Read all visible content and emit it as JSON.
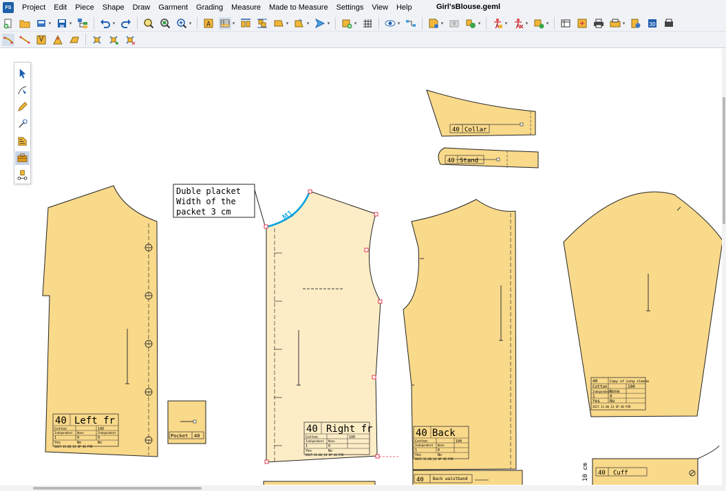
{
  "app": {
    "logo": "FS",
    "title": "Girl'sBlouse.geml"
  },
  "menu": [
    "Project",
    "Edit",
    "Piece",
    "Shape",
    "Draw",
    "Garment",
    "Grading",
    "Measure",
    "Made to Measure",
    "Settings",
    "View",
    "Help"
  ],
  "colors": {
    "piece_fill": "#f9d98a",
    "selected_fill": "#fdedc6",
    "outline": "#222222",
    "accent": "#00a2e0",
    "point": "#e0334b"
  },
  "annotation": {
    "line1": "Duble placket",
    "line2": "Width of the",
    "line3": "packet 3 cm",
    "curve_label": "M1"
  },
  "pieces": {
    "left_front": {
      "size": "40",
      "name": "Left fr",
      "fabric": "Cotton",
      "qty": "100",
      "r2a": "Independent",
      "r2b": "None",
      "r2c": "Independent",
      "r3a": "1",
      "r3b": "0",
      "r3c": "0",
      "r4a": "Yes",
      "r4b": "No",
      "r4c": "No",
      "date": "2017.11.06_14 GP 46 PSR"
    },
    "pocket": {
      "label": "Pocket",
      "size": "40"
    },
    "right_front": {
      "size": "40",
      "name": "Right fr",
      "fabric": "Cotton",
      "qty": "100",
      "r2a": "Independent",
      "r2b": "None",
      "r3a": "1",
      "r3b": "0",
      "r4a": "Yes",
      "r4b": "No",
      "date": "2017.11.06_14 GP 46 PSR"
    },
    "back": {
      "size": "40",
      "name": "Back",
      "fabric": "Cotton",
      "qty": "100",
      "r2a": "Independent",
      "r2b": "None",
      "r3a": "1",
      "r3b": "0",
      "r4a": "Yes",
      "r4b": "No",
      "date": "2017.11.06_14 GP 46 PSR"
    },
    "collar": {
      "size": "40",
      "name": "Collar"
    },
    "stand": {
      "size": "40",
      "name": "Stand"
    },
    "sleeve": {
      "size": "40",
      "name": "Copy of Long sleeve",
      "fabric": "Cotton",
      "qty": "100",
      "r2a": "Independent",
      "r2b": "None",
      "r3a": "1",
      "r3b": "0",
      "r4a": "Yes",
      "r4b": "No",
      "date": "2017.11.06_14 GP 46 PSR"
    },
    "cuff": {
      "size": "40",
      "name": "Cuff",
      "dim": "10 cm"
    },
    "back_waistband": {
      "size": "40",
      "name": "Back waistband"
    }
  }
}
